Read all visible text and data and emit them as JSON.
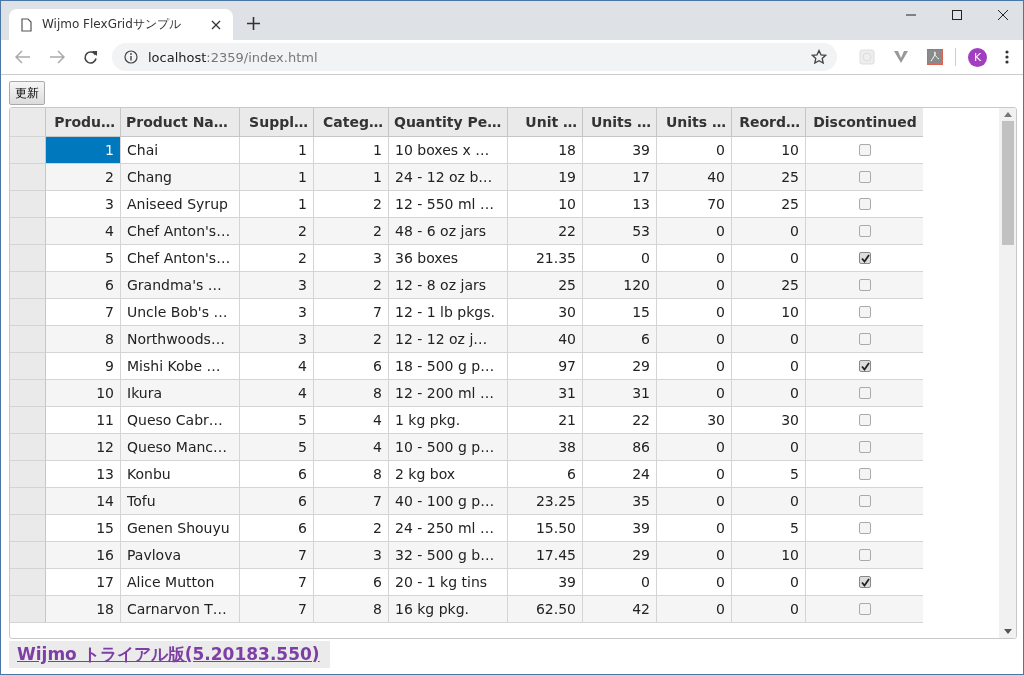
{
  "browser": {
    "tab": {
      "title": "Wijmo FlexGridサンプル"
    },
    "address": {
      "host": "localhost",
      "path": ":2359/index.html"
    },
    "avatar": "K"
  },
  "page": {
    "refresh_button": "更新",
    "grid": {
      "columns": [
        {
          "header": "Produ…",
          "kind": "number"
        },
        {
          "header": "Product Na…",
          "kind": "text"
        },
        {
          "header": "Suppl…",
          "kind": "number"
        },
        {
          "header": "Categ…",
          "kind": "number"
        },
        {
          "header": "Quantity Pe…",
          "kind": "text"
        },
        {
          "header": "Unit …",
          "kind": "number"
        },
        {
          "header": "Units …",
          "kind": "number"
        },
        {
          "header": "Units …",
          "kind": "number"
        },
        {
          "header": "Reord…",
          "kind": "number"
        },
        {
          "header": "Discontinued",
          "kind": "check"
        }
      ],
      "rows": [
        {
          "selected": true,
          "cells": [
            "1",
            "Chai",
            "1",
            "1",
            "10 boxes x …",
            "18",
            "39",
            "0",
            "10"
          ],
          "discontinued": false
        },
        {
          "selected": false,
          "cells": [
            "2",
            "Chang",
            "1",
            "1",
            "24 - 12 oz b…",
            "19",
            "17",
            "40",
            "25"
          ],
          "discontinued": false
        },
        {
          "selected": false,
          "cells": [
            "3",
            "Aniseed Syrup",
            "1",
            "2",
            "12 - 550 ml …",
            "10",
            "13",
            "70",
            "25"
          ],
          "discontinued": false
        },
        {
          "selected": false,
          "cells": [
            "4",
            "Chef Anton's…",
            "2",
            "2",
            "48 - 6 oz jars",
            "22",
            "53",
            "0",
            "0"
          ],
          "discontinued": false
        },
        {
          "selected": false,
          "cells": [
            "5",
            "Chef Anton's…",
            "2",
            "3",
            "36 boxes",
            "21.35",
            "0",
            "0",
            "0"
          ],
          "discontinued": true
        },
        {
          "selected": false,
          "cells": [
            "6",
            "Grandma's …",
            "3",
            "2",
            "12 - 8 oz jars",
            "25",
            "120",
            "0",
            "25"
          ],
          "discontinued": false
        },
        {
          "selected": false,
          "cells": [
            "7",
            "Uncle Bob's …",
            "3",
            "7",
            "12 - 1 lb pkgs.",
            "30",
            "15",
            "0",
            "10"
          ],
          "discontinued": false
        },
        {
          "selected": false,
          "cells": [
            "8",
            "Northwoods…",
            "3",
            "2",
            "12 - 12 oz j…",
            "40",
            "6",
            "0",
            "0"
          ],
          "discontinued": false
        },
        {
          "selected": false,
          "cells": [
            "9",
            "Mishi Kobe …",
            "4",
            "6",
            "18 - 500 g p…",
            "97",
            "29",
            "0",
            "0"
          ],
          "discontinued": true
        },
        {
          "selected": false,
          "cells": [
            "10",
            "Ikura",
            "4",
            "8",
            "12 - 200 ml …",
            "31",
            "31",
            "0",
            "0"
          ],
          "discontinued": false
        },
        {
          "selected": false,
          "cells": [
            "11",
            "Queso Cabr…",
            "5",
            "4",
            "1 kg pkg.",
            "21",
            "22",
            "30",
            "30"
          ],
          "discontinued": false
        },
        {
          "selected": false,
          "cells": [
            "12",
            "Queso Manc…",
            "5",
            "4",
            "10 - 500 g p…",
            "38",
            "86",
            "0",
            "0"
          ],
          "discontinued": false
        },
        {
          "selected": false,
          "cells": [
            "13",
            "Konbu",
            "6",
            "8",
            "2 kg box",
            "6",
            "24",
            "0",
            "5"
          ],
          "discontinued": false
        },
        {
          "selected": false,
          "cells": [
            "14",
            "Tofu",
            "6",
            "7",
            "40 - 100 g p…",
            "23.25",
            "35",
            "0",
            "0"
          ],
          "discontinued": false
        },
        {
          "selected": false,
          "cells": [
            "15",
            "Genen Shouyu",
            "6",
            "2",
            "24 - 250 ml …",
            "15.50",
            "39",
            "0",
            "5"
          ],
          "discontinued": false
        },
        {
          "selected": false,
          "cells": [
            "16",
            "Pavlova",
            "7",
            "3",
            "32 - 500 g b…",
            "17.45",
            "29",
            "0",
            "10"
          ],
          "discontinued": false
        },
        {
          "selected": false,
          "cells": [
            "17",
            "Alice Mutton",
            "7",
            "6",
            "20 - 1 kg tins",
            "39",
            "0",
            "0",
            "0"
          ],
          "discontinued": true
        },
        {
          "selected": false,
          "cells": [
            "18",
            "Carnarvon T…",
            "7",
            "8",
            "16 kg pkg.",
            "62.50",
            "42",
            "0",
            "0"
          ],
          "discontinued": false
        }
      ]
    },
    "trial_link": "Wijmo トライアル版(5.20183.550)"
  }
}
